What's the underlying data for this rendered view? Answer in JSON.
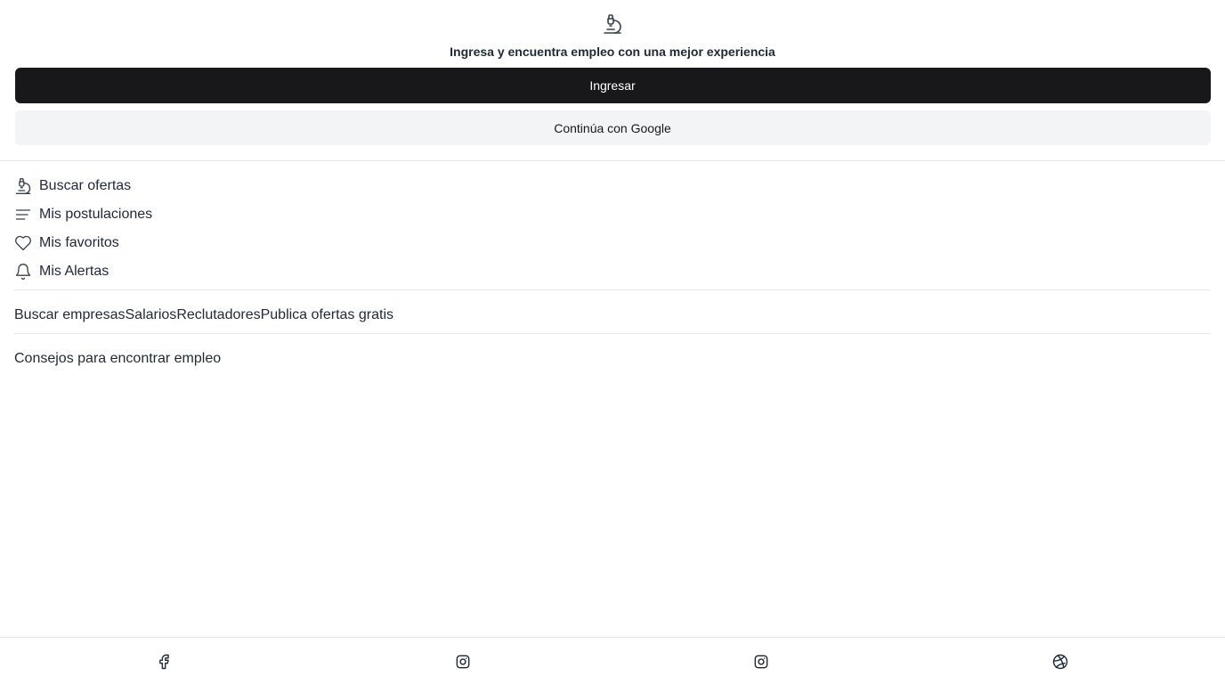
{
  "header": {
    "logo_icon": "microscope-icon",
    "tagline": "Ingresa y encuentra empleo con una mejor experiencia",
    "login_label": "Ingresar",
    "google_label": "Continúa con Google"
  },
  "menu": {
    "items": [
      {
        "label": "Buscar ofertas",
        "icon": "microscope-icon"
      },
      {
        "label": "Mis postulaciones",
        "icon": "list-icon"
      },
      {
        "label": "Mis favoritos",
        "icon": "heart-icon"
      },
      {
        "label": "Mis Alertas",
        "icon": "bell-icon"
      }
    ]
  },
  "links": {
    "companies": "Buscar empresas",
    "salaries": "Salarios",
    "recruiters": "Reclutadores",
    "publish": "Publica ofertas gratis"
  },
  "tips": {
    "label": "Consejos para encontrar empleo"
  },
  "footer": {
    "social": [
      {
        "icon": "facebook-icon"
      },
      {
        "icon": "instagram-icon"
      },
      {
        "icon": "instagram-icon"
      },
      {
        "icon": "dribbble-icon"
      }
    ]
  },
  "colors": {
    "primary_button": "#18181b",
    "secondary_button": "#f3f4f6",
    "divider": "#e5e7eb",
    "text": "#1f2937"
  }
}
